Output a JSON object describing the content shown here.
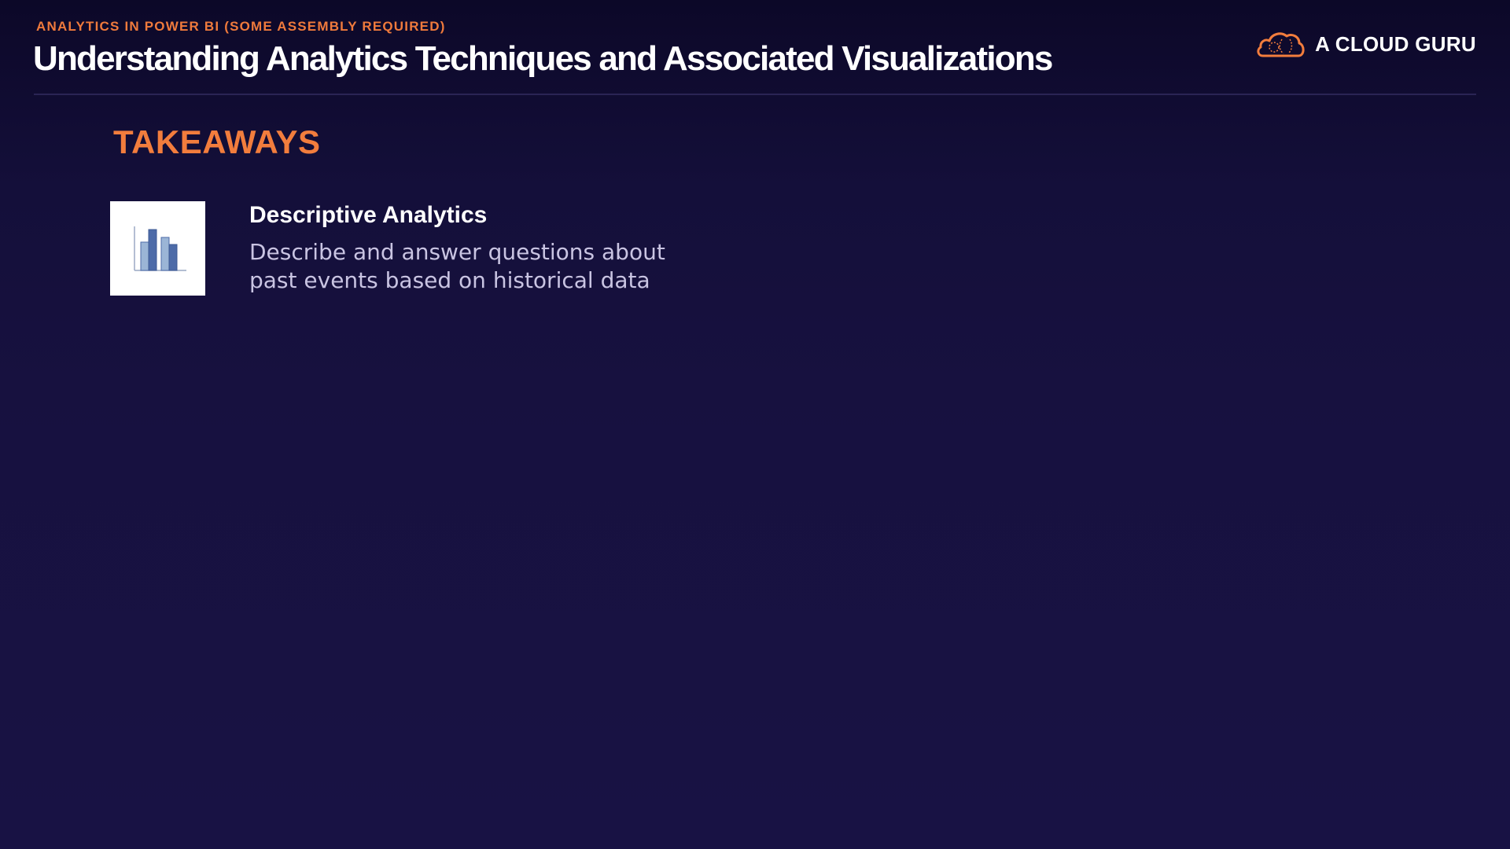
{
  "header": {
    "course": "ANALYTICS IN POWER BI (SOME ASSEMBLY REQUIRED)",
    "title": "Understanding Analytics Techniques and Associated Visualizations"
  },
  "brand": {
    "name": "A CLOUD GURU",
    "logo_icon": "cloud-logo-icon"
  },
  "section": {
    "heading": "TAKEAWAYS"
  },
  "takeaways": [
    {
      "icon": "bar-chart-icon",
      "title": "Descriptive Analytics",
      "description_lines": [
        "Describe and answer questions about",
        "past events based on historical data"
      ]
    }
  ],
  "colors": {
    "accent": "#f27d3d",
    "background_top": "#0c0828",
    "background_bottom": "#181244",
    "description_text": "#c9c4e2",
    "chart_bar_dark": "#4d6ba8",
    "chart_bar_light": "#9bb5d6"
  }
}
